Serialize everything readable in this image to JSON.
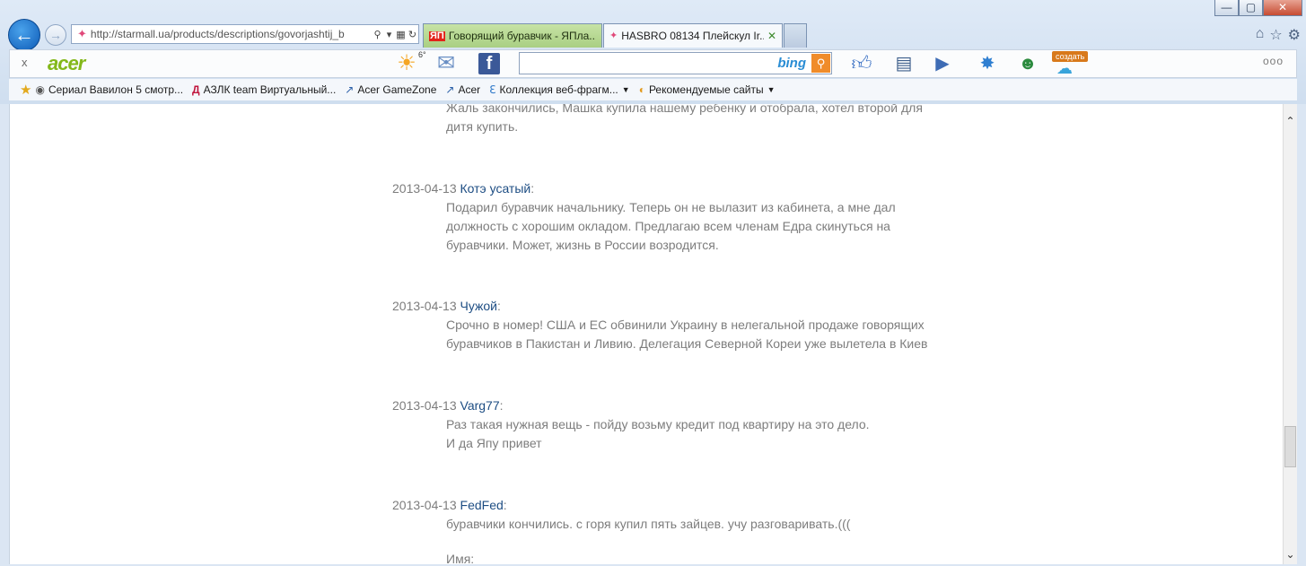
{
  "browser": {
    "address": "http://starmall.ua/products/descriptions/govorjashtij_b",
    "tabs": [
      {
        "title": "Говорящий буравчик - ЯПла...",
        "favicon": "ЯП"
      },
      {
        "title": "HASBRO 08134 Плейскул Ir...",
        "close": "✕"
      }
    ],
    "window_buttons": {
      "minimize": "—",
      "maximize": "▢",
      "close": "✕"
    }
  },
  "toolbar": {
    "close": "x",
    "logo": "acer",
    "weather_temp": "6°",
    "search_engine": "bing",
    "create_badge": "создать",
    "more": "ooo"
  },
  "favorites": [
    {
      "label": "Сериал Вавилон 5 смотр...",
      "icon": "eye-icon"
    },
    {
      "label": "АЗЛК team Виртуальный...",
      "icon": "azlk-icon"
    },
    {
      "label": "Acer GameZone",
      "icon": "link-icon"
    },
    {
      "label": "Acer",
      "icon": "link-icon"
    },
    {
      "label": "Коллекция веб-фрагм...",
      "icon": "ie-icon",
      "dropdown": true
    },
    {
      "label": "Рекомендуемые сайты",
      "icon": "rec-icon",
      "dropdown": true
    }
  ],
  "comments_top": {
    "lines": [
      "Жаль закончились, Машка купила нашему ребенку и отобрала, хотел второй для",
      "дитя купить."
    ]
  },
  "comments": [
    {
      "date": "2013-04-13",
      "author": "Котэ усатый",
      "lines": [
        "Подарил буравчик начальнику. Теперь он не вылазит из кабинета, а мне дал",
        "должность с хорошим окладом. Предлагаю всем членам Едра скинуться на",
        "буравчики. Может, жизнь в России возродится."
      ]
    },
    {
      "date": "2013-04-13",
      "author": "Чужой",
      "lines": [
        "Срочно в номер! США и ЕС обвинили Украину в нелегальной продаже говорящих",
        "буравчиков в Пакистан и Ливию. Делегация Северной Кореи уже вылетела в Киев"
      ]
    },
    {
      "date": "2013-04-13",
      "author": "Varg77",
      "lines": [
        "Раз такая нужная вещь - пойду возьму кредит под квартиру на это дело.",
        "И да Япу привет"
      ]
    },
    {
      "date": "2013-04-13",
      "author": "FedFed",
      "lines": [
        "буравчики кончились. с горя купил пять зайцев. учу разговаривать.((("
      ]
    }
  ],
  "form": {
    "name_label": "Имя:"
  }
}
